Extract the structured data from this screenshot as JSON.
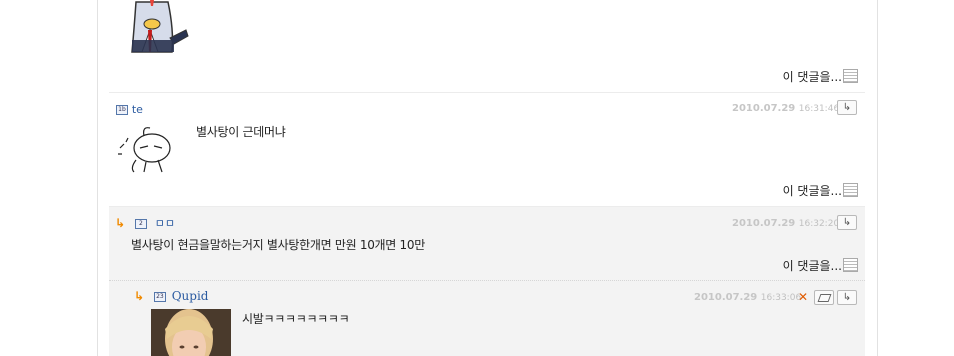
{
  "comments": [
    {
      "more_label": "이 댓글을..."
    },
    {
      "level": "1b",
      "author": "te",
      "date": "2010.07.29",
      "time": "16:31:46",
      "body": "별사탕이 근데머냐",
      "more_label": "이 댓글을..."
    },
    {
      "level": "2",
      "author": "ㅁㅁ",
      "date": "2010.07.29",
      "time": "16:32:20",
      "body": "별사탕이 현금을말하는거지 별사탕한개면 만원 10개면 10만",
      "more_label": "이 댓글을..."
    },
    {
      "level": "23",
      "author": "Qupid",
      "date": "2010.07.29",
      "time": "16:33:06",
      "body": "시발ㅋㅋㅋㅋㅋㅋㅋㅋ"
    }
  ],
  "colors": {
    "nickname": "#2a5aa0",
    "reply_arrow": "#f08a00",
    "reply_background": "#f3f3f3",
    "date": "#c6c6c6"
  }
}
